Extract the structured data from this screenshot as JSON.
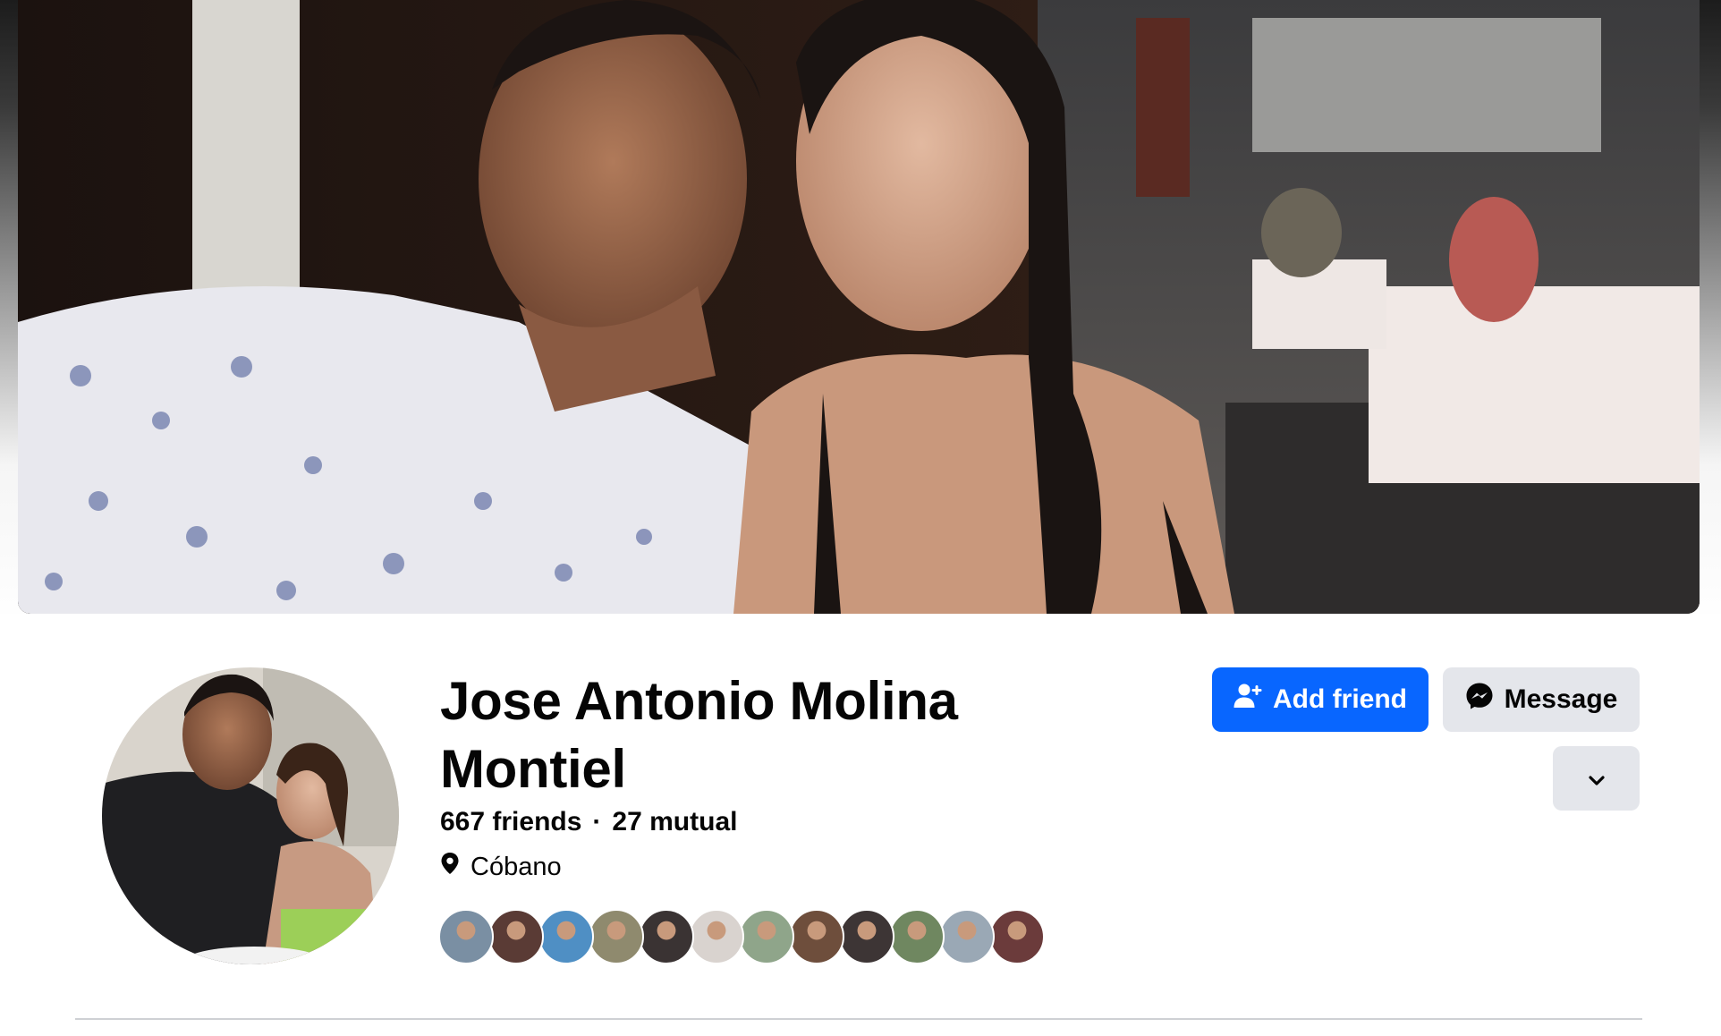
{
  "profile": {
    "name": "Jose Antonio Molina Montiel",
    "friends_count": "667 friends",
    "separator": "·",
    "mutual_count": "27 mutual",
    "location": "Cóbano",
    "location_icon": "map-pin-icon"
  },
  "actions": {
    "add_friend_label": "Add friend",
    "add_friend_icon": "add-person-icon",
    "message_label": "Message",
    "message_icon": "messenger-icon",
    "more_icon": "chevron-down-icon"
  },
  "colors": {
    "primary": "#0866ff",
    "secondary_button": "#e4e6eb",
    "divider": "#ced0d4",
    "text": "#050505"
  },
  "mutual_friend_avatars": [
    {
      "tone": "#7a8fa3"
    },
    {
      "tone": "#5a3b35"
    },
    {
      "tone": "#4f8fc4"
    },
    {
      "tone": "#8f8a6e"
    },
    {
      "tone": "#3a3333"
    },
    {
      "tone": "#d9d3cf"
    },
    {
      "tone": "#8fa58a"
    },
    {
      "tone": "#6e4e3c"
    },
    {
      "tone": "#3d3535"
    },
    {
      "tone": "#6f8760"
    },
    {
      "tone": "#9aa8b5"
    },
    {
      "tone": "#6b3b3b"
    }
  ]
}
